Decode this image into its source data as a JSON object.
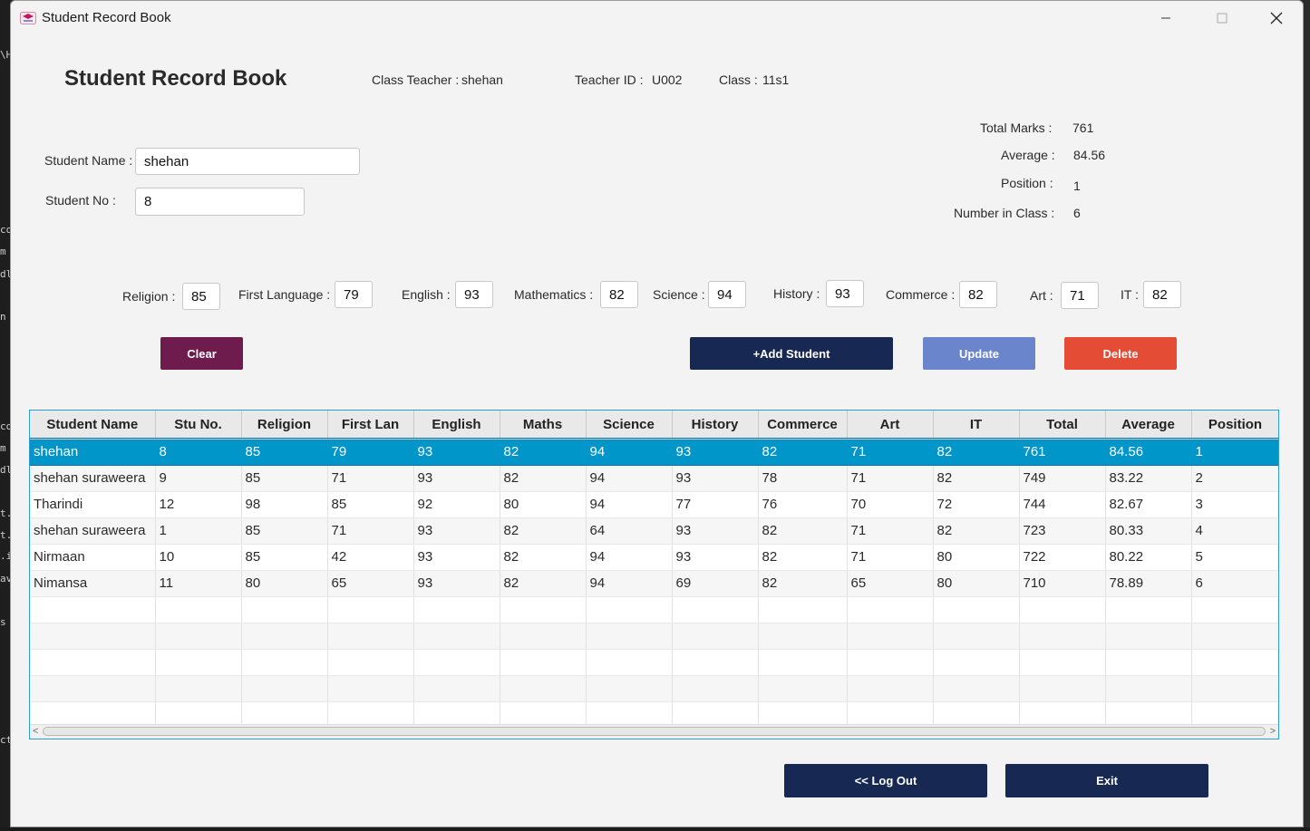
{
  "window": {
    "title": "Student Record Book",
    "controls": {
      "minimize": "─",
      "maximize": "☐",
      "close": "✕"
    }
  },
  "header": {
    "heading": "Student Record Book",
    "class_teacher_label": "Class Teacher :",
    "class_teacher_value": "shehan",
    "teacher_id_label": "Teacher ID :",
    "teacher_id_value": "U002",
    "class_label": "Class :",
    "class_value": "11s1"
  },
  "student": {
    "name_label": "Student Name :",
    "name_value": "shehan",
    "no_label": "Student No :",
    "no_value": "8"
  },
  "summary": {
    "total_label": "Total Marks :",
    "total_value": "761",
    "average_label": "Average :",
    "average_value": "84.56",
    "position_label": "Position :",
    "position_value": "1",
    "count_label": "Number in Class :",
    "count_value": "6"
  },
  "subjects": [
    {
      "label": "Religion :",
      "value": "85"
    },
    {
      "label": "First Language :",
      "value": "79"
    },
    {
      "label": "English :",
      "value": "93"
    },
    {
      "label": "Mathematics :",
      "value": "82"
    },
    {
      "label": "Science :",
      "value": "94"
    },
    {
      "label": "History :",
      "value": "93"
    },
    {
      "label": "Commerce :",
      "value": "82"
    },
    {
      "label": "Art :",
      "value": "71"
    },
    {
      "label": "IT :",
      "value": "82"
    }
  ],
  "buttons": {
    "clear": "Clear",
    "add": "+Add Student",
    "update": "Update",
    "delete": "Delete",
    "logout": "<< Log Out",
    "exit": "Exit"
  },
  "table": {
    "columns": [
      "Student Name",
      "Stu No.",
      "Religion",
      "First Lan",
      "English",
      "Maths",
      "Science",
      "History",
      "Commerce",
      "Art",
      "IT",
      "Total",
      "Average",
      "Position"
    ],
    "rows": [
      [
        "shehan",
        "8",
        "85",
        "79",
        "93",
        "82",
        "94",
        "93",
        "82",
        "71",
        "82",
        "761",
        "84.56",
        "1"
      ],
      [
        "shehan suraweera",
        "9",
        "85",
        "71",
        "93",
        "82",
        "94",
        "93",
        "78",
        "71",
        "82",
        "749",
        "83.22",
        "2"
      ],
      [
        "Tharindi",
        "12",
        "98",
        "85",
        "92",
        "80",
        "94",
        "77",
        "76",
        "70",
        "72",
        "744",
        "82.67",
        "3"
      ],
      [
        "shehan suraweera",
        "1",
        "85",
        "71",
        "93",
        "82",
        "64",
        "93",
        "82",
        "71",
        "82",
        "723",
        "80.33",
        "4"
      ],
      [
        "Nirmaan",
        "10",
        "85",
        "42",
        "93",
        "82",
        "94",
        "93",
        "82",
        "71",
        "80",
        "722",
        "80.22",
        "5"
      ],
      [
        "Nimansa",
        "11",
        "80",
        "65",
        "93",
        "82",
        "94",
        "69",
        "82",
        "65",
        "80",
        "710",
        "78.89",
        "6"
      ]
    ],
    "selected_row": 0,
    "empty_rows": 5
  },
  "scrollbar": {
    "left_arrow": "<",
    "right_arrow": ">"
  },
  "background_fragments": [
    "\\H",
    "co",
    "m",
    "dl",
    "n",
    "co",
    "m",
    "dl",
    "t.",
    "t.",
    ".i",
    "av",
    "s",
    "ct"
  ],
  "colors": {
    "clear": "#6e1b4e",
    "primary": "#172852",
    "update": "#6b85cc",
    "delete": "#e44c35",
    "selection": "#0096c9",
    "table_border": "#2f9bd3"
  }
}
